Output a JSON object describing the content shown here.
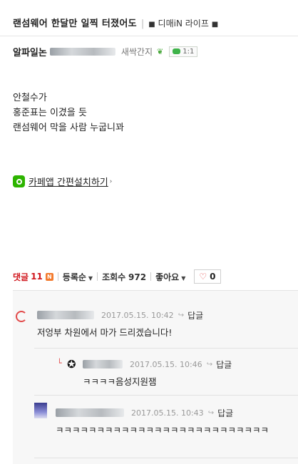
{
  "header": {
    "post_title": "랜섬웨어 한달만 일찍 터졌어도",
    "cafe_name_prefix": "■",
    "cafe_name": "디매iN 라이프",
    "cafe_name_suffix": "■"
  },
  "author": {
    "nickname": "알파일논",
    "grade": "새싹간지",
    "chat_count": "1:1"
  },
  "body": {
    "lines": [
      "안철수가",
      "홍준표는 이겼을 듯",
      "랜섬웨어 막을 사람 누굽니꽈"
    ]
  },
  "app_link": {
    "label": "카페앱 간편설치하기"
  },
  "stats": {
    "comment_label": "댓글",
    "comment_count": "11",
    "new_badge": "N",
    "sort_label": "등록순",
    "views_label": "조회수",
    "views_count": "972",
    "like_label": "좋아요",
    "like_count": "0"
  },
  "comments": [
    {
      "date": "2017.05.15. 10:42",
      "reply_label": "답글",
      "text": "저엉부 차원에서 마가 드리겠습니다!"
    },
    {
      "date": "2017.05.15. 10:46",
      "reply_label": "답글",
      "text": "ㅋㅋㅋㅋ음성지원잼"
    },
    {
      "date": "2017.05.15. 10:43",
      "reply_label": "답글",
      "text": "ㅋㅋㅋㅋㅋㅋㅋㅋㅋㅋㅋㅋㅋㅋㅋㅋㅋㅋㅋㅋㅋㅋㅋㅋㅋㅋ"
    }
  ],
  "colors": {
    "accent_red": "#d0161d",
    "sprout_green": "#49a83b",
    "app_green": "#2db400"
  }
}
